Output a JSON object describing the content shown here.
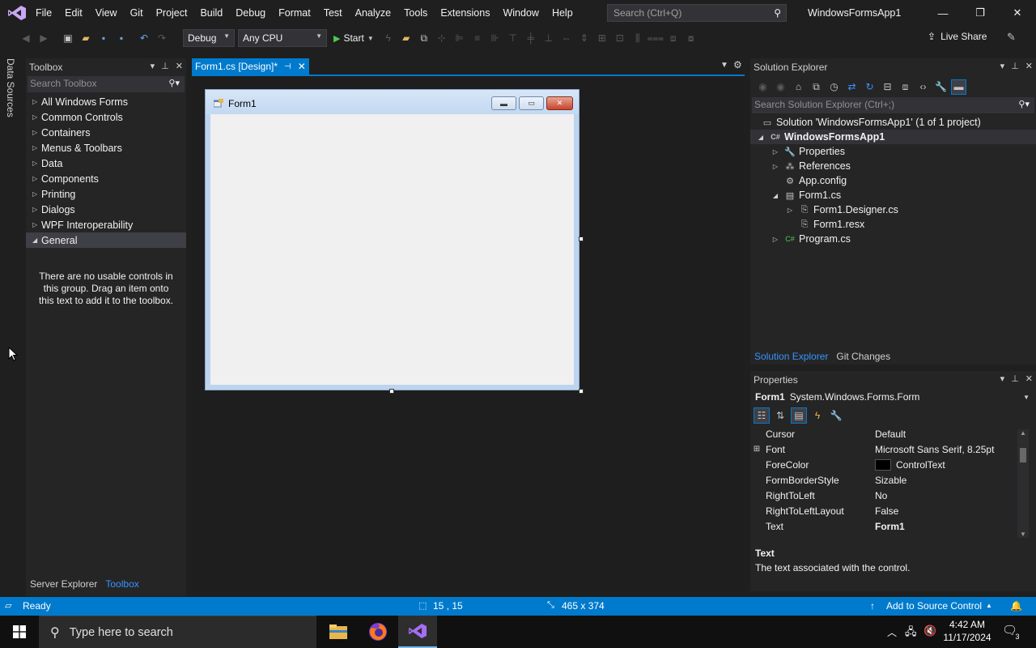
{
  "menu": [
    "File",
    "Edit",
    "View",
    "Git",
    "Project",
    "Build",
    "Debug",
    "Format",
    "Test",
    "Analyze",
    "Tools",
    "Extensions",
    "Window",
    "Help"
  ],
  "search": {
    "placeholder": "Search (Ctrl+Q)"
  },
  "app_title": "WindowsFormsApp1",
  "toolbar": {
    "config": "Debug",
    "platform": "Any CPU",
    "start": "Start",
    "live_share": "Live Share"
  },
  "left_strip": {
    "data_sources": "Data Sources"
  },
  "toolbox": {
    "title": "Toolbox",
    "search_placeholder": "Search Toolbox",
    "groups": [
      "All Windows Forms",
      "Common Controls",
      "Containers",
      "Menus & Toolbars",
      "Data",
      "Components",
      "Printing",
      "Dialogs",
      "WPF Interoperability",
      "General"
    ],
    "empty_message": "There are no usable controls in this group. Drag an item onto this text to add it to the toolbox.",
    "tabs": [
      "Server Explorer",
      "Toolbox"
    ]
  },
  "document_tab": {
    "label": "Form1.cs [Design]*"
  },
  "form": {
    "title": "Form1"
  },
  "solution_explorer": {
    "title": "Solution Explorer",
    "search_placeholder": "Search Solution Explorer (Ctrl+;)",
    "tree": [
      {
        "label": "Solution 'WindowsFormsApp1' (1 of 1 project)",
        "level": 0,
        "expander": "",
        "icon": "solution-icon",
        "bold": false
      },
      {
        "label": "WindowsFormsApp1",
        "level": 0,
        "expander": "open",
        "icon": "csharp-project-icon",
        "bold": true
      },
      {
        "label": "Properties",
        "level": 1,
        "expander": "closed",
        "icon": "wrench-icon",
        "bold": false
      },
      {
        "label": "References",
        "level": 1,
        "expander": "closed",
        "icon": "references-icon",
        "bold": false
      },
      {
        "label": "App.config",
        "level": 1,
        "expander": "",
        "icon": "config-icon",
        "bold": false
      },
      {
        "label": "Form1.cs",
        "level": 1,
        "expander": "open",
        "icon": "form-icon",
        "bold": false
      },
      {
        "label": "Form1.Designer.cs",
        "level": 2,
        "expander": "closed",
        "icon": "file-icon",
        "bold": false
      },
      {
        "label": "Form1.resx",
        "level": 2,
        "expander": "",
        "icon": "file-icon",
        "bold": false
      },
      {
        "label": "Program.cs",
        "level": 1,
        "expander": "closed",
        "icon": "csharp-file-icon",
        "bold": false
      }
    ],
    "tabs": [
      "Solution Explorer",
      "Git Changes"
    ]
  },
  "properties": {
    "title": "Properties",
    "object_name": "Form1",
    "object_type": "System.Windows.Forms.Form",
    "rows": [
      {
        "name": "Cursor",
        "value": "Default",
        "expandable": false,
        "swatch": false,
        "bold": false
      },
      {
        "name": "Font",
        "value": "Microsoft Sans Serif, 8.25pt",
        "expandable": true,
        "swatch": false,
        "bold": false
      },
      {
        "name": "ForeColor",
        "value": "ControlText",
        "expandable": false,
        "swatch": true,
        "bold": false
      },
      {
        "name": "FormBorderStyle",
        "value": "Sizable",
        "expandable": false,
        "swatch": false,
        "bold": false
      },
      {
        "name": "RightToLeft",
        "value": "No",
        "expandable": false,
        "swatch": false,
        "bold": false
      },
      {
        "name": "RightToLeftLayout",
        "value": "False",
        "expandable": false,
        "swatch": false,
        "bold": false
      },
      {
        "name": "Text",
        "value": "Form1",
        "expandable": false,
        "swatch": false,
        "bold": true
      }
    ],
    "description_title": "Text",
    "description_text": "The text associated with the control."
  },
  "status": {
    "ready": "Ready",
    "position": "15 , 15",
    "size": "465 x 374",
    "source_control": "Add to Source Control"
  },
  "taskbar": {
    "search_placeholder": "Type here to search",
    "time": "4:42 AM",
    "date": "11/17/2024",
    "notifications": "3"
  },
  "colors": {
    "accent": "#007acc",
    "background": "#1f1f1f",
    "panel": "#252526"
  }
}
